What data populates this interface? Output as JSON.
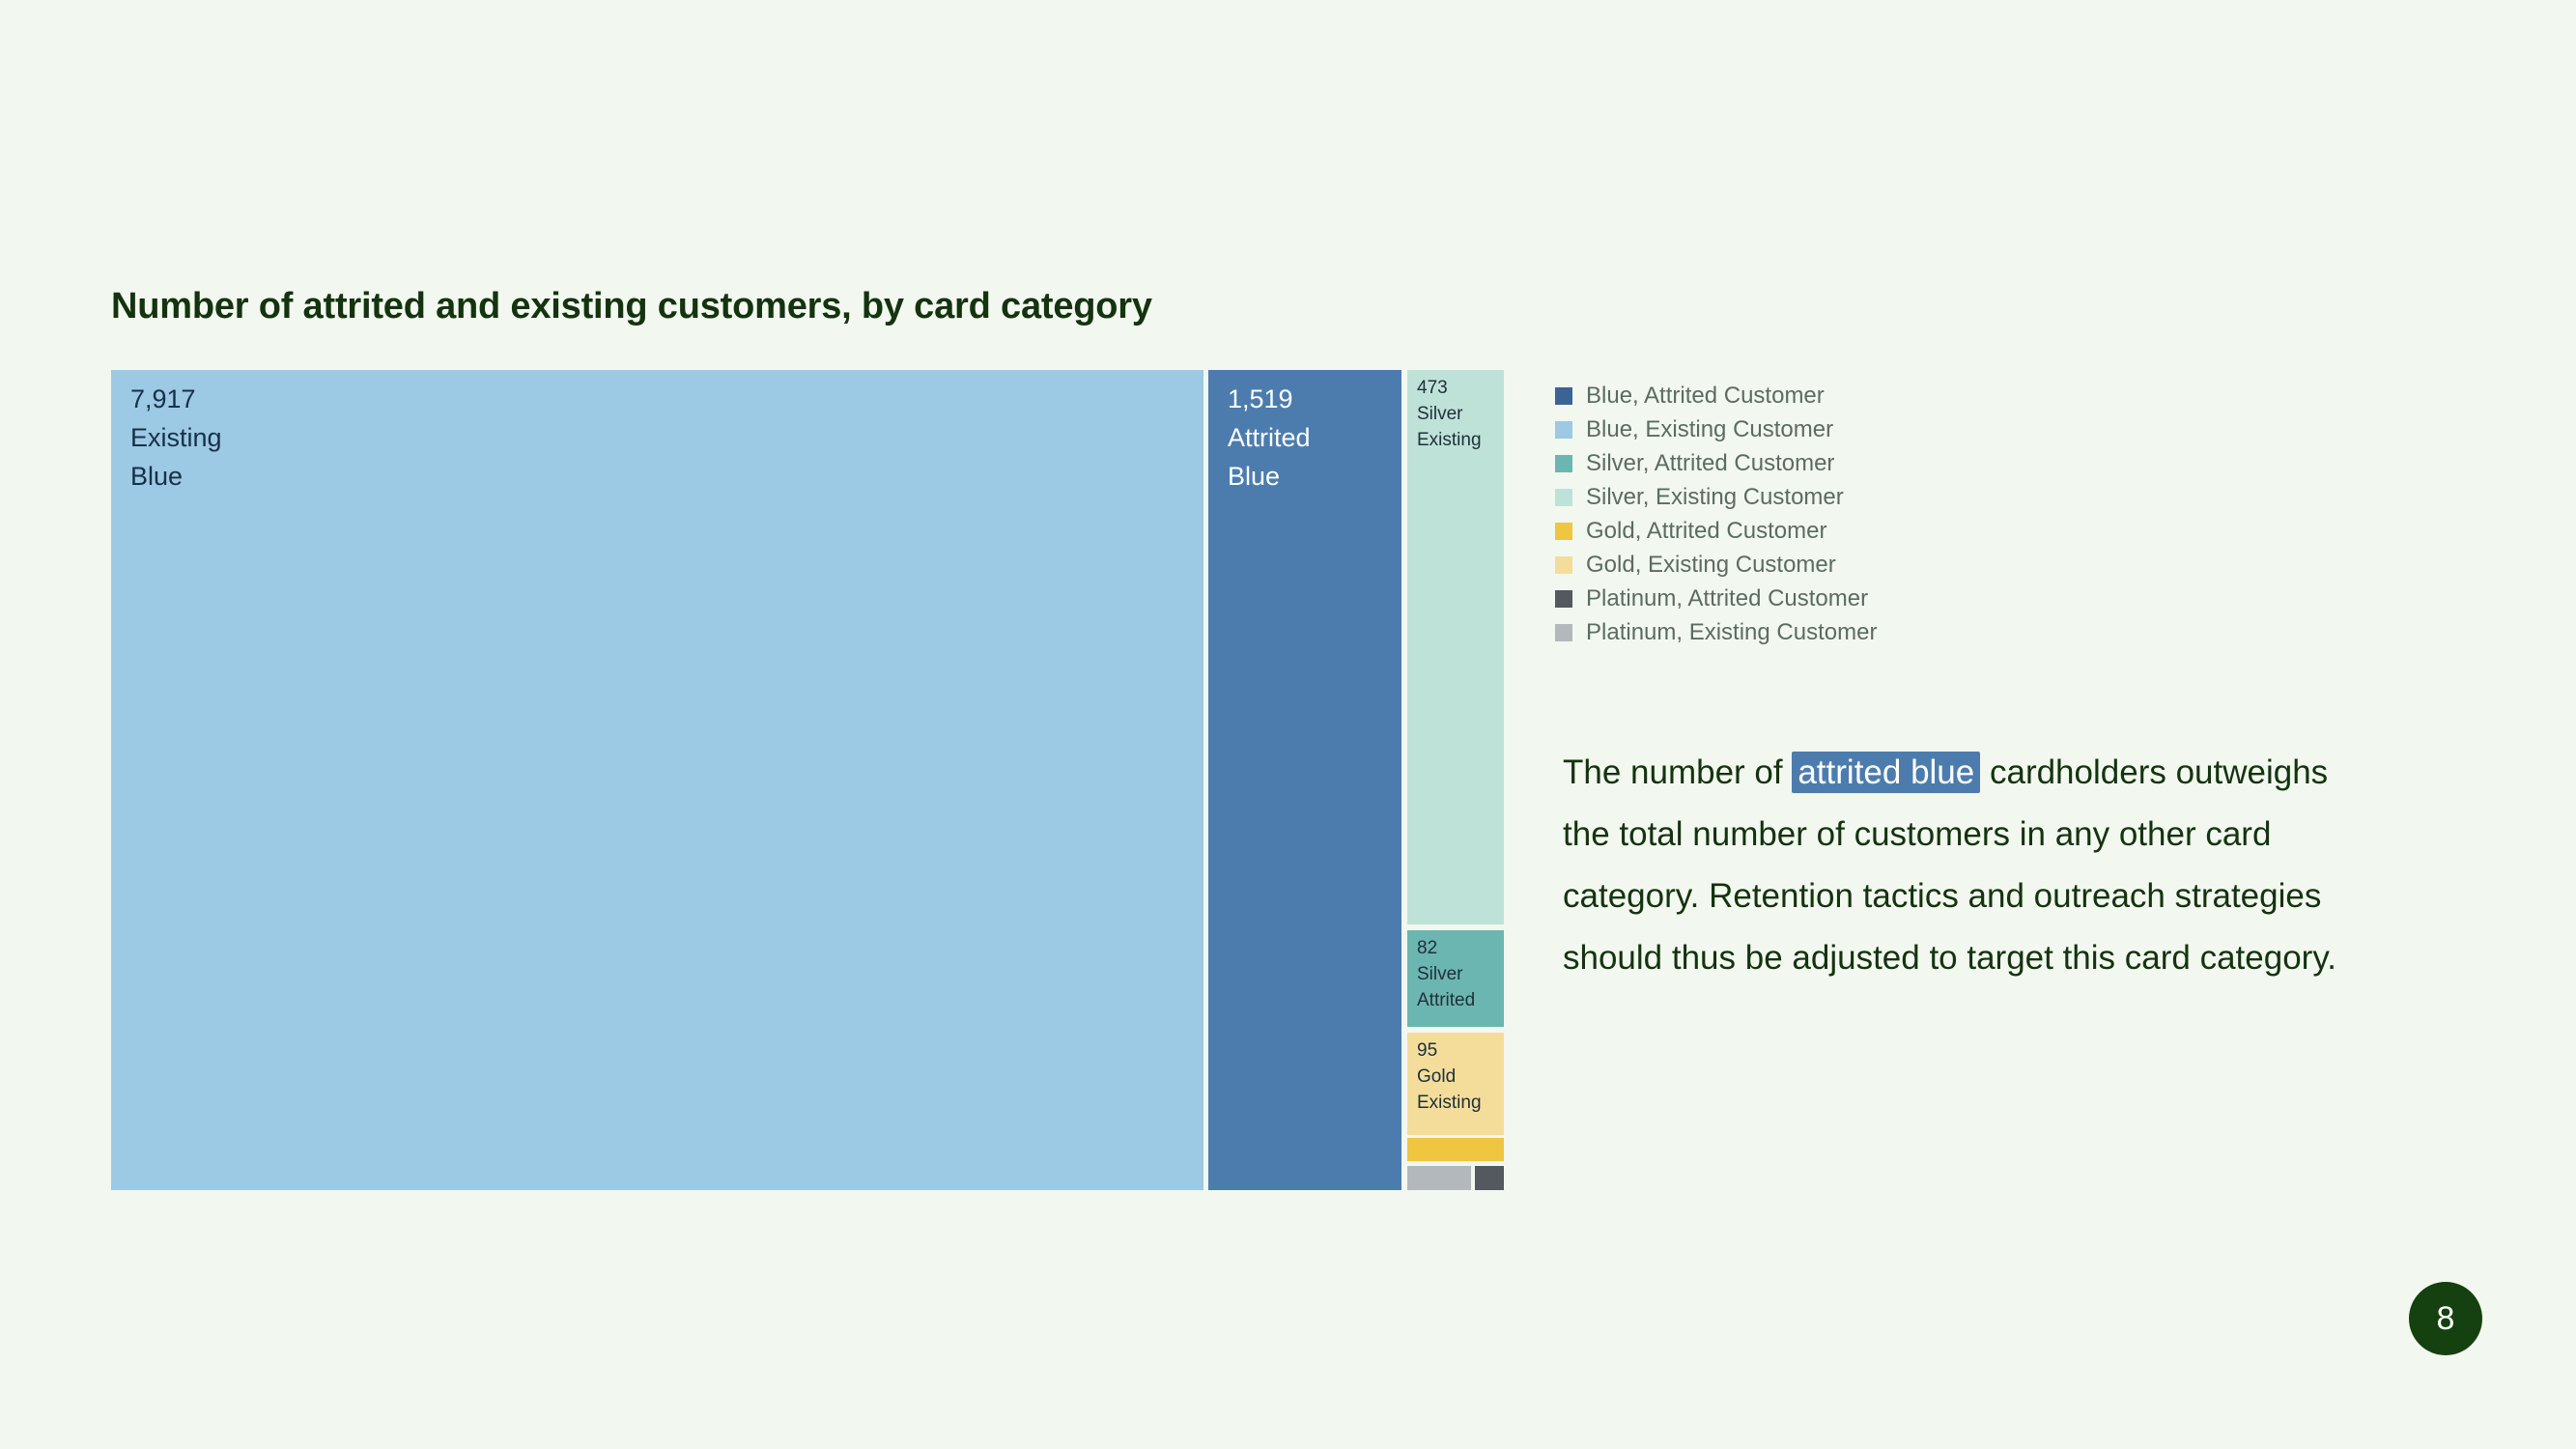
{
  "slide": {
    "title": "Number of attrited and existing customers, by card category",
    "page_number": "8",
    "background_color": "#f2f8ef"
  },
  "chart_data": {
    "type": "treemap",
    "title": "Number of attrited and existing customers, by card category",
    "xlabel": "",
    "ylabel": "",
    "grid": false,
    "legend_position": "right",
    "value_label": "Number of customers",
    "categories": [
      "Blue",
      "Silver",
      "Gold",
      "Platinum"
    ],
    "status": [
      "Attrited Customer",
      "Existing Customer"
    ],
    "nodes": [
      {
        "id": "blue-existing",
        "label_value": "7,917",
        "label_status": "Existing",
        "label_category": "Blue",
        "value": 7917,
        "category": "Blue",
        "status": "Existing Customer",
        "color": "#9cc9e3",
        "text_color": "#17304a"
      },
      {
        "id": "blue-attrited",
        "label_value": "1,519",
        "label_status": "Attrited",
        "label_category": "Blue",
        "value": 1519,
        "category": "Blue",
        "status": "Attrited Customer",
        "color": "#4c7cae",
        "text_color": "#ffffff"
      },
      {
        "id": "silver-existing",
        "label_value": "473",
        "label_status": "Silver",
        "label_category": "Existing",
        "value": 473,
        "category": "Silver",
        "status": "Existing Customer",
        "color": "#bfe2d8",
        "text_color": "#20303a"
      },
      {
        "id": "silver-attrited",
        "label_value": "82",
        "label_status": "Silver",
        "label_category": "Attrited",
        "value": 82,
        "category": "Silver",
        "status": "Attrited Customer",
        "color": "#6bb6b0",
        "text_color": "#20303a"
      },
      {
        "id": "gold-existing",
        "label_value": "95",
        "label_status": "Gold",
        "label_category": "Existing",
        "value": 95,
        "category": "Gold",
        "status": "Existing Customer",
        "color": "#f4dd9b",
        "text_color": "#20303a"
      },
      {
        "id": "gold-attrited",
        "label_value": "",
        "label_status": "",
        "label_category": "",
        "value": 21,
        "category": "Gold",
        "status": "Attrited Customer",
        "color": "#efc63f",
        "text_color": "#20303a"
      },
      {
        "id": "platinum-existing",
        "label_value": "",
        "label_status": "",
        "label_category": "",
        "value": 15,
        "category": "Platinum",
        "status": "Existing Customer",
        "color": "#b3b8bd",
        "text_color": "#20303a"
      },
      {
        "id": "platinum-attrited",
        "label_value": "",
        "label_status": "",
        "label_category": "",
        "value": 5,
        "category": "Platinum",
        "status": "Attrited Customer",
        "color": "#53595f",
        "text_color": "#ffffff"
      }
    ]
  },
  "legend": {
    "items": [
      {
        "label": "Blue, Attrited Customer",
        "color": "#3b6394"
      },
      {
        "label": "Blue, Existing Customer",
        "color": "#9cc9e3"
      },
      {
        "label": "Silver, Attrited Customer",
        "color": "#6bb6b0"
      },
      {
        "label": "Silver, Existing Customer",
        "color": "#bfe2d8"
      },
      {
        "label": "Gold, Attrited Customer",
        "color": "#efc63f"
      },
      {
        "label": "Gold, Existing Customer",
        "color": "#f4dd9b"
      },
      {
        "label": "Platinum, Attrited Customer",
        "color": "#53595f"
      },
      {
        "label": "Platinum, Existing Customer",
        "color": "#b3b8bd"
      }
    ]
  },
  "annotation": {
    "before": "The number of ",
    "highlight": "attrited blue",
    "after": " cardholders outweighs the total number of customers in any other card category. Retention tactics and outreach strategies should thus be adjusted to target this card category.",
    "highlight_color": "#4c7cae"
  }
}
